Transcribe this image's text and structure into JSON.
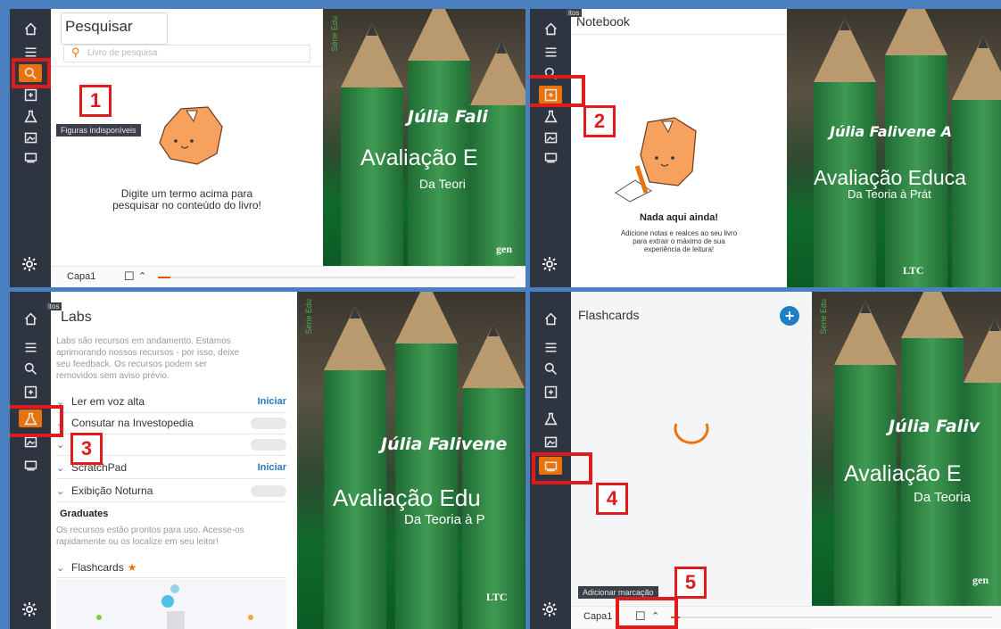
{
  "panel1": {
    "tooltip_top": "",
    "search_title": "Pesquisar",
    "search_placeholder": "Livro de pesquisa",
    "figures_tooltip": "Figuras indisponíveis",
    "empty_text_1": "Digite um termo acima para",
    "empty_text_2": "pesquisar no conteúdo do livro!",
    "page_label": "Capa1",
    "badge": "1"
  },
  "panel2": {
    "tooltip_top": "itos",
    "title": "Notebook",
    "empty_title": "Nada aqui ainda!",
    "empty_text_1": "Adicione notas e realces ao seu livro",
    "empty_text_2": "para extrair o máximo de sua",
    "empty_text_3": "experiência de leitura!",
    "badge": "2"
  },
  "panel3": {
    "tooltip_top": "itos",
    "title": "Labs",
    "intro_1": "Labs são recursos em andamento. Estamos",
    "intro_2": "aprimorando nossos recursos - por isso, deixe",
    "intro_3": "seu feedback. Os recursos podem ser",
    "intro_4": "removidos sem aviso prévio.",
    "rows": [
      {
        "label": "Ler em voz alta",
        "action": "Iniciar"
      },
      {
        "label": "Consutar na Investopedia",
        "action": ""
      },
      {
        "label": "nir",
        "action": ""
      },
      {
        "label": "ScratchPad",
        "action": "Iniciar"
      },
      {
        "label": "Exibição Noturna",
        "action": ""
      }
    ],
    "graduates_title": "Graduates",
    "graduates_1": "Os recursos estão prontos para uso. Acesse-os",
    "graduates_2": "rapidamente ou os localize em seu leitor!",
    "flashcards_label": "Flashcards",
    "badge": "3"
  },
  "panel4": {
    "title": "Flashcards",
    "tooltip": "Adicionar marcação",
    "page_label": "Capa1",
    "badge4": "4",
    "badge5": "5"
  },
  "cover": {
    "author_short": "Júlia Fali",
    "author_mid": "Júlia Falivene A",
    "author_p3": "Júlia Falivene",
    "author_p4": "Júlia Faliv",
    "title_p1": "Avaliação E",
    "title_p2": "Avaliação Educa",
    "title_p3": "Avaliação Edu",
    "title_p4": "Avaliação E",
    "sub_p1": "Da Teori",
    "sub_p2": "Da Teoria à Prát",
    "sub_p3": "Da Teoria à P",
    "sub_p4": "Da Teoria",
    "publisher": "LTC",
    "gen": "gen",
    "spine": "Série Edu"
  },
  "colors": {
    "accent": "#e8720c",
    "sidebar": "#2e3440",
    "link": "#2f78c4",
    "annotation": "#e01b1b"
  }
}
